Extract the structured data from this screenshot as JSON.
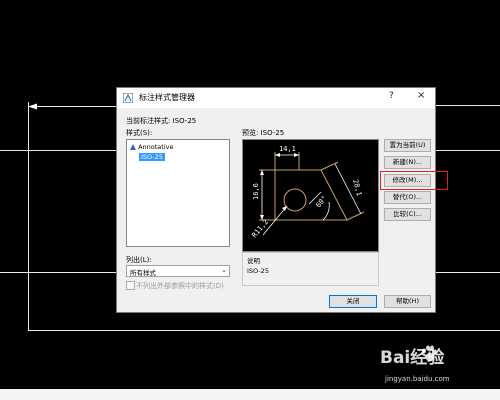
{
  "dialog": {
    "title": "标注样式管理器",
    "help_glyph": "?",
    "close_glyph": "×",
    "current_style_label": "当前标注样式: ISO-25",
    "styles_label": "样式(S):",
    "styles": [
      "Annotative",
      "ISO-25"
    ],
    "selected_style": "ISO-25",
    "preview_label": "预览: ISO-25",
    "list_label": "列出(L):",
    "list_value": "所有样式",
    "xref_checkbox_label": "不列出外部参照中的样式(D)",
    "description_label": "说明",
    "description_value": "ISO-25",
    "buttons": {
      "set_current": "置为当前(U)",
      "new": "新建(N)...",
      "modify": "修改(M)...",
      "override": "替代(O)...",
      "compare": "比较(C)...",
      "close": "关闭",
      "help": "帮助(H)"
    }
  },
  "preview_dims": {
    "top": "14,1",
    "left": "16,6",
    "right": "28,1",
    "angle": "60°",
    "radius": "R11,2"
  },
  "watermark": {
    "brand": "Bai经验",
    "url": "jingyan.baidu.com"
  },
  "colors": {
    "preview_shape": "#c8a060",
    "highlight": "#e02020",
    "selection": "#3399ff"
  }
}
